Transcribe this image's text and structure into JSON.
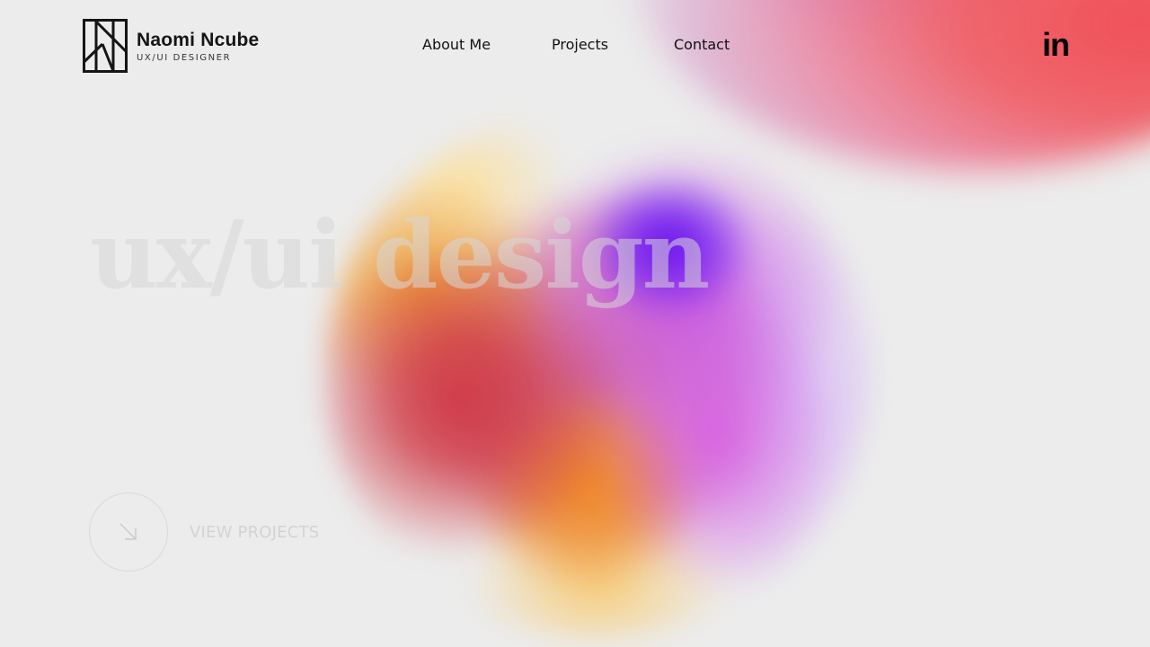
{
  "brand": {
    "name": "Naomi Ncube",
    "role": "UX/UI DESIGNER",
    "logo_icon": "nk-monogram-icon"
  },
  "nav": {
    "items": [
      {
        "label": "About Me"
      },
      {
        "label": "Projects"
      },
      {
        "label": "Contact"
      }
    ]
  },
  "social": {
    "linkedin_label": "in",
    "icon": "linkedin-icon"
  },
  "hero": {
    "title": "ux/ui design"
  },
  "cta": {
    "label": "VIEW PROJECTS",
    "icon": "arrow-down-right-icon"
  },
  "colors": {
    "background": "#ececec",
    "text": "#111111",
    "gradient_red": "#f04f57",
    "gradient_violet": "#6a10f0",
    "gradient_orange": "#f08a25",
    "gradient_yellow": "#fbe0a0"
  }
}
